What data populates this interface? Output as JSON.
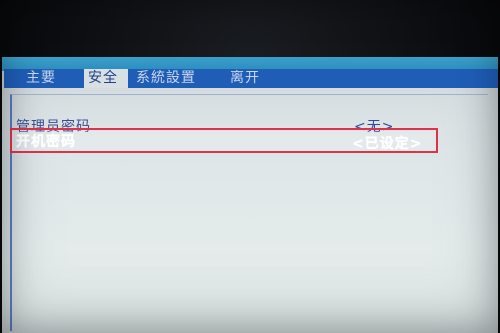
{
  "menubar": {
    "tabs": [
      {
        "label": "主要"
      },
      {
        "label": "安全"
      },
      {
        "label": "系統設置"
      },
      {
        "label": "离开"
      }
    ]
  },
  "security": {
    "admin_password": {
      "label": "管理员密码",
      "value": "<无>"
    },
    "boot_password": {
      "label": "开机密码",
      "value": "<已设定>"
    }
  },
  "colors": {
    "menubar_bg": "#1f5db6",
    "active_tab_bg": "#d8e0e4",
    "screen_bg": "#dfe6e8",
    "highlight_border": "#e0314a"
  }
}
